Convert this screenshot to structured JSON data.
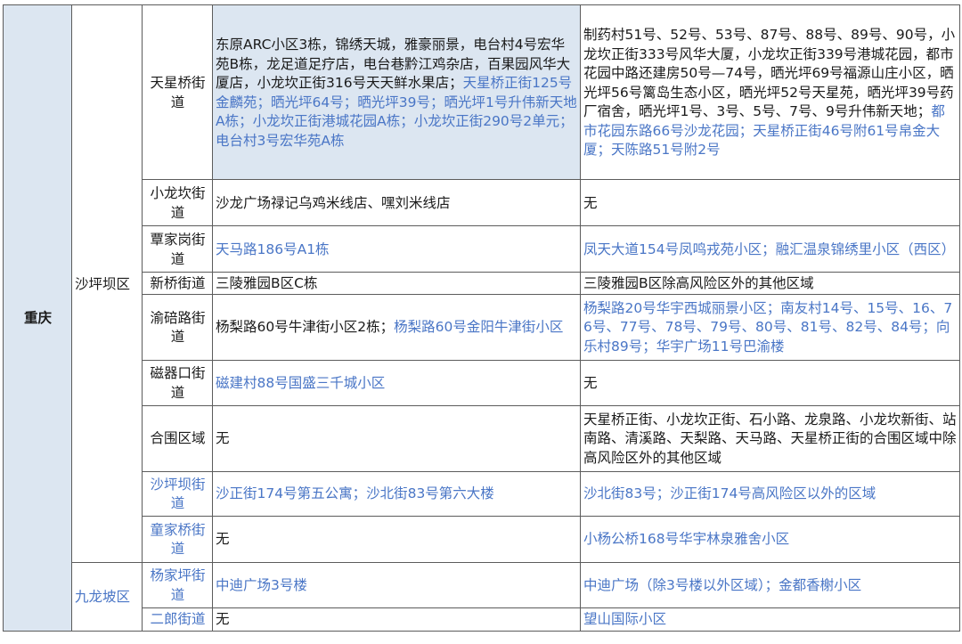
{
  "city": "重庆",
  "districts": [
    {
      "name": "沙坪坝区",
      "color": "#1a1a1a",
      "rows": [
        {
          "street": "天星桥街道",
          "street_color": "#1a1a1a",
          "high_risk": [
            {
              "text": "东原ARC小区3栋，锦绣天城，雅豪丽景，电台村4号宏华苑B栋，龙足道足疗店，电台巷黔江鸡杂店，百果园风华大厦店，小龙坎正街316号天天鲜水果店；",
              "color": "#1a1a1a"
            },
            {
              "text": "天星桥正街125号金麟苑；晒光坪64号；晒光坪39号；晒光坪1号升伟新天地A栋；小龙坎正街港城花园A栋；小龙坎正街290号2单元；电台村3号宏华苑A栋",
              "color": "#4a76c6"
            }
          ],
          "mid_risk": [
            {
              "text": "制药村51号、52号、53号、87号、88号、89号、90号，小龙坎正街333号风华大厦，小龙坎正街339号港城花园，都市花园中路还建房50号—74号，晒光坪69号福源山庄小区，晒光坪56号篱岛生态小区，晒光坪52号天星苑，晒光坪39号药厂宿舍，晒光坪1号、3号、5号、7号、9号升伟新天地；",
              "color": "#1a1a1a"
            },
            {
              "text": "都市花园东路66号沙龙花园；天星桥正街46号附61号帛金大厦；天陈路51号附2号",
              "color": "#4a76c6"
            }
          ]
        },
        {
          "street": "小龙坎街道",
          "street_color": "#1a1a1a",
          "high_risk": [
            {
              "text": "沙龙广场禄记乌鸡米线店、嘿刘米线店",
              "color": "#1a1a1a"
            }
          ],
          "mid_risk": [
            {
              "text": "无",
              "color": "#1a1a1a"
            }
          ]
        },
        {
          "street": "覃家岗街道",
          "street_color": "#1a1a1a",
          "high_risk": [
            {
              "text": "天马路186号A1栋",
              "color": "#4a76c6"
            }
          ],
          "mid_risk": [
            {
              "text": "凤天大道154号凤鸣戎苑小区；融汇温泉锦绣里小区（西区）",
              "color": "#4a76c6"
            }
          ]
        },
        {
          "street": "新桥街道",
          "street_color": "#1a1a1a",
          "high_risk": [
            {
              "text": "三陵雅园B区C栋",
              "color": "#1a1a1a"
            }
          ],
          "mid_risk": [
            {
              "text": "三陵雅园B区除高风险区外的其他区域",
              "color": "#1a1a1a"
            }
          ]
        },
        {
          "street": "渝碚路街道",
          "street_color": "#1a1a1a",
          "high_risk": [
            {
              "text": "杨梨路60号牛津街小区2栋；",
              "color": "#1a1a1a"
            },
            {
              "text": "杨梨路60号金阳牛津街小区",
              "color": "#4a76c6"
            }
          ],
          "mid_risk": [
            {
              "text": "杨梨路20号华宇西城丽景小区；南友村14号、15号、16、76号、77号、78号、79号、80号、81号、82号、84号；向乐村89号；华宇广场11号巴渝楼",
              "color": "#4a76c6"
            }
          ]
        },
        {
          "street": "磁器口街道",
          "street_color": "#1a1a1a",
          "high_risk": [
            {
              "text": "磁建村88号国盛三千城小区",
              "color": "#4a76c6"
            }
          ],
          "mid_risk": [
            {
              "text": "无",
              "color": "#1a1a1a"
            }
          ]
        },
        {
          "street": "合围区域",
          "street_color": "#1a1a1a",
          "high_risk": [
            {
              "text": "无",
              "color": "#1a1a1a"
            }
          ],
          "mid_risk": [
            {
              "text": "天星桥正街、小龙坎正街、石小路、龙泉路、小龙坎新街、站南路、清溪路、天梨路、天马路、天星桥正街的合围区域中除高风险区外的其他区域",
              "color": "#1a1a1a"
            }
          ]
        },
        {
          "street": "沙坪坝街道",
          "street_color": "#4a76c6",
          "high_risk": [
            {
              "text": "沙正街174号第五公寓；沙北街83号第六大楼",
              "color": "#4a76c6"
            }
          ],
          "mid_risk": [
            {
              "text": "沙北街83号；沙正街174号高风险区以外的区域",
              "color": "#4a76c6"
            }
          ]
        },
        {
          "street": "童家桥街道",
          "street_color": "#4a76c6",
          "high_risk": [
            {
              "text": "无",
              "color": "#1a1a1a"
            }
          ],
          "mid_risk": [
            {
              "text": "小杨公桥168号华宇林泉雅舍小区",
              "color": "#4a76c6"
            }
          ]
        }
      ]
    },
    {
      "name": "九龙坡区",
      "color": "#4a76c6",
      "rows": [
        {
          "street": "杨家坪街道",
          "street_color": "#4a76c6",
          "high_risk": [
            {
              "text": "中迪广场3号楼",
              "color": "#4a76c6"
            }
          ],
          "mid_risk": [
            {
              "text": "中迪广场（除3号楼以外区域）；金都香榭小区",
              "color": "#4a76c6"
            }
          ]
        },
        {
          "street": "二郎街道",
          "street_color": "#4a76c6",
          "high_risk": [
            {
              "text": "无",
              "color": "#1a1a1a"
            }
          ],
          "mid_risk": [
            {
              "text": "望山国际小区",
              "color": "#4a76c6"
            }
          ]
        }
      ]
    }
  ]
}
